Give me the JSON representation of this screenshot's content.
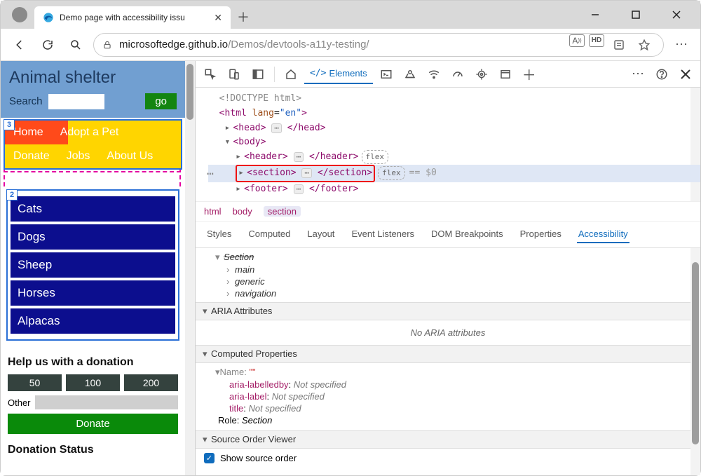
{
  "tab": {
    "title": "Demo page with accessibility issu"
  },
  "url": {
    "host": "microsoftedge.github.io",
    "path": "/Demos/devtools-a11y-testing/"
  },
  "page": {
    "header_title": "Animal shelter",
    "search_label": "Search",
    "go_label": "go",
    "nav": [
      "Home",
      "Adopt a Pet",
      "Donate",
      "Jobs",
      "About Us"
    ],
    "badge3": "3",
    "badge2": "2",
    "categories": [
      "Cats",
      "Dogs",
      "Sheep",
      "Horses",
      "Alpacas"
    ],
    "donation_heading": "Help us with a donation",
    "amounts": [
      "50",
      "100",
      "200"
    ],
    "other_label": "Other",
    "donate_label": "Donate",
    "status_heading": "Donation Status"
  },
  "devtools": {
    "tabs": {
      "elements": "Elements"
    },
    "dom": {
      "doctype": "<!DOCTYPE html>",
      "html_open": "<html ",
      "lang_attr": "lang",
      "lang_val": "\"en\"",
      "html_close": ">",
      "head_open": "<head>",
      "head_close": "</head>",
      "body_open": "<body>",
      "header_open": "<header>",
      "header_close": "</header>",
      "section_open": "<section>",
      "section_close": "</section>",
      "footer_open": "<footer>",
      "footer_close": "</footer>",
      "flex": "flex",
      "eq": "== $0"
    },
    "crumbs": [
      "html",
      "body",
      "section"
    ],
    "subtabs": [
      "Styles",
      "Computed",
      "Layout",
      "Event Listeners",
      "DOM Breakpoints",
      "Properties",
      "Accessibility"
    ],
    "tree": {
      "section": "Section",
      "main": "main",
      "generic": "generic",
      "navigation": "navigation"
    },
    "sections": {
      "aria_head": "ARIA Attributes",
      "aria_empty": "No ARIA attributes",
      "computed_head": "Computed Properties",
      "name_label": "Name: ",
      "name_value": "\"\"",
      "aria_labelledby": "aria-labelledby",
      "ns": "Not specified",
      "aria_label": "aria-label",
      "title": "title",
      "role_label": "Role: ",
      "role_value": "Section",
      "source_head": "Source Order Viewer",
      "show_source": "Show source order"
    }
  }
}
